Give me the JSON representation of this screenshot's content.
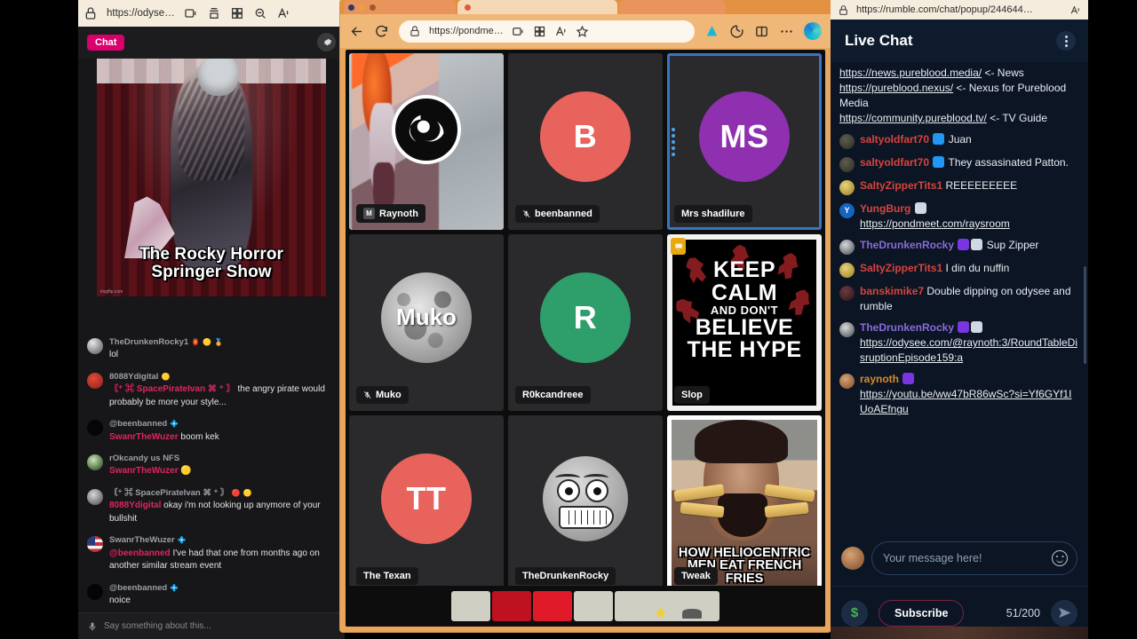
{
  "left_window": {
    "browser": {
      "url": "https://odyse…",
      "url_bold": "odyse"
    },
    "chat_label": "Chat",
    "stream_thumbnail": {
      "title_line1": "The Rocky Horror",
      "title_line2": "Springer Show",
      "watermark": "imgflip.com"
    },
    "messages": [
      {
        "user": "TheDrunkenRocky1",
        "badges": [
          "🏮",
          "🟡",
          "🏅"
        ],
        "avatar": "av-rock",
        "mention": "",
        "text": "lol"
      },
      {
        "user": "8088Ydigital",
        "badges": [
          "🟡"
        ],
        "avatar": "av-tomato",
        "mention": "〘⁺ ⌘ SpacePirateIvan ⌘ ⁺ 〙",
        "text": "the angry pirate would probably be more your style..."
      },
      {
        "user": "@beenbanned",
        "badges": [
          "💠"
        ],
        "avatar": "av-black",
        "mention": "SwanrTheWuzer",
        "text": "boom kek"
      },
      {
        "user": "rOkcandy us NFS",
        "badges": [],
        "avatar": "av-green",
        "mention": "SwanrTheWuzer",
        "text": "🟡"
      },
      {
        "user": "〘⁺ ⌘ SpacePirateIvan ⌘ ⁺ 〙",
        "badges": [
          "🔴",
          "🟡"
        ],
        "avatar": "av-grey",
        "mention": "8088Ydigital",
        "text": "okay i'm not looking up anymore of your bullshit"
      },
      {
        "user": "SwanrTheWuzer",
        "badges": [
          "💠"
        ],
        "avatar": "av-flag",
        "mention": "@beenbanned",
        "text": "I've had that one from months ago on another similar stream event"
      },
      {
        "user": "@beenbanned",
        "badges": [
          "💠"
        ],
        "avatar": "av-black",
        "mention": "",
        "text": "noice"
      }
    ],
    "composer_placeholder": "Say something about this...",
    "settings_icon": "gear-icon"
  },
  "mid_window": {
    "browser": {
      "url": "https://pondme…",
      "url_bold": "pondme"
    },
    "toolbar_icons": [
      "back-arrow-icon",
      "reload-icon",
      "lock-icon",
      "split-screen-icon",
      "collections-icon",
      "read-aloud-icon",
      "favorite-star-icon",
      "extension-icon",
      "browser-essentials-icon",
      "split-pane-icon",
      "more-options-icon",
      "copilot-icon"
    ],
    "tiles": [
      {
        "name": "Raynoth",
        "kind": "photo",
        "muted": false,
        "badge": "M",
        "initials": "",
        "color": ""
      },
      {
        "name": "beenbanned",
        "kind": "initials",
        "muted": true,
        "badge": "",
        "initials": "B",
        "color": "#e8635c"
      },
      {
        "name": "Mrs shadilure",
        "kind": "initials",
        "muted": false,
        "badge": "",
        "initials": "MS",
        "color": "#8e30b0",
        "active": true
      },
      {
        "name": "Muko",
        "kind": "moon",
        "muted": true,
        "badge": "",
        "initials": "Muko",
        "color": ""
      },
      {
        "name": "R0kcandreee",
        "kind": "initials",
        "muted": false,
        "badge": "",
        "initials": "R",
        "color": "#2e9e6b"
      },
      {
        "name": "Slop",
        "kind": "meme-keepcalm",
        "muted": false,
        "badge": "",
        "initials": "",
        "color": "",
        "meme_lines": [
          "KEEP",
          "CALM",
          "AND DON'T",
          "BELIEVE",
          "THE HYPE"
        ]
      },
      {
        "name": "The Texan",
        "kind": "initials",
        "muted": false,
        "badge": "",
        "initials": "TT",
        "color": "#e8635c"
      },
      {
        "name": "TheDrunkenRocky",
        "kind": "troll",
        "muted": false,
        "badge": "",
        "initials": "",
        "color": ""
      },
      {
        "name": "Tweak",
        "kind": "meme-fries",
        "muted": false,
        "badge": "",
        "initials": "",
        "color": "",
        "meme_lines": [
          "HOW HELIOCENTRIC",
          "MEN EAT FRENCH FRIES"
        ]
      }
    ]
  },
  "right_window": {
    "browser": {
      "url": "https://rumble.com/chat/popup/244644…",
      "url_bold": "rumble.com"
    },
    "title": "Live Chat",
    "messages": [
      {
        "type": "links",
        "avatar": "",
        "lines": [
          {
            "link": "https://news.pureblood.media/",
            "suffix": " <- News"
          },
          {
            "link": "https://pureblood.nexus/",
            "suffix": " <- Nexus for Pureblood Media"
          },
          {
            "link": "https://community.pureblood.tv/",
            "suffix": " <- TV Guide"
          }
        ]
      },
      {
        "type": "text",
        "avatar": "a1",
        "user": "saltyoldfart70",
        "user_color": "n-red",
        "badges": [
          "b-blue"
        ],
        "text": "Juan"
      },
      {
        "type": "text",
        "avatar": "a1",
        "user": "saltyoldfart70",
        "user_color": "n-red",
        "badges": [
          "b-blue"
        ],
        "text": "They assasinated Patton."
      },
      {
        "type": "text",
        "avatar": "a2",
        "user": "SaltyZipperTits1",
        "user_color": "n-red",
        "badges": [],
        "text": "REEEEEEEEE"
      },
      {
        "type": "text-link",
        "avatar": "a3",
        "avatar_letter": "Y",
        "user": "YungBurg",
        "user_color": "n-red",
        "badges": [
          "b-white"
        ],
        "text": "",
        "link": "https://pondmeet.com/raysroom"
      },
      {
        "type": "text",
        "avatar": "a4",
        "user": "TheDrunkenRocky",
        "user_color": "n-purple",
        "badges": [
          "b-purple",
          "b-white"
        ],
        "text": "Sup Zipper"
      },
      {
        "type": "text",
        "avatar": "a2",
        "user": "SaltyZipperTits1",
        "user_color": "n-red",
        "badges": [],
        "text": "I din du nuffin"
      },
      {
        "type": "text",
        "avatar": "a5",
        "user": "banskimike7",
        "user_color": "n-red",
        "badges": [],
        "text": "Double dipping on odysee and rumble"
      },
      {
        "type": "text-link",
        "avatar": "a4",
        "user": "TheDrunkenRocky",
        "user_color": "n-purple",
        "badges": [
          "b-purple",
          "b-white"
        ],
        "text": "",
        "link": "https://odysee.com/@raynoth:3/RoundTableDisruptionEpisode159:a"
      },
      {
        "type": "text-link",
        "avatar": "a6",
        "user": "raynoth",
        "user_color": "n-orange",
        "badges": [
          "b-purple"
        ],
        "text": "",
        "link": "https://youtu.be/ww47bR86wSc?si=Yf6GYf1IUoAEfngu"
      }
    ],
    "composer_placeholder": "Your message here!",
    "subscribe_label": "Subscribe",
    "char_count": "51/200",
    "rant_icon": "dollar-icon",
    "send_icon": "send-icon",
    "emoji_icon": "smiley-icon"
  }
}
